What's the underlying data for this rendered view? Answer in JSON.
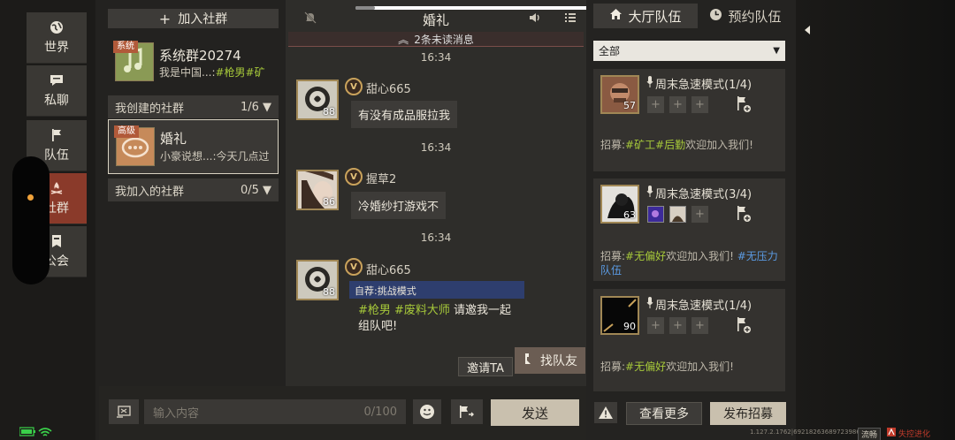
{
  "nav": {
    "items": [
      {
        "label": "世界",
        "icon": "globe-icon"
      },
      {
        "label": "私聊",
        "icon": "chat-bubble-icon"
      },
      {
        "label": "队伍",
        "icon": "flag-icon"
      },
      {
        "label": "社群",
        "icon": "campfire-icon"
      },
      {
        "label": "公会",
        "icon": "guild-banner-icon"
      }
    ],
    "active": "社群"
  },
  "community": {
    "add_label": "加入社群",
    "system_group": {
      "tag": "系统",
      "name": "系统群20274",
      "msg_prefix": "我是中国...:",
      "msg_hashtags": "#枪男#矿"
    },
    "created_section": {
      "label": "我创建的社群",
      "count": "1/6"
    },
    "created_group": {
      "tag": "高级",
      "name": "婚礼",
      "msg": "小豪说想...:今天几点过"
    },
    "joined_section": {
      "label": "我加入的社群",
      "count": "0/5"
    }
  },
  "chat": {
    "title": "婚礼",
    "unread": "2条未读消息",
    "messages": [
      {
        "time": "16:34",
        "sender": "甜心665",
        "level": "88",
        "vip": "V",
        "text": "有没有成品服拉我"
      },
      {
        "time": "16:34",
        "sender": "握草2",
        "level": "86",
        "vip": "V",
        "text": "冷婚纱打游戏不"
      },
      {
        "time": "16:34",
        "sender": "甜心665",
        "level": "88",
        "vip": "V",
        "invite_mode": "自荐:挑战模式",
        "invite_tags": "#枪男 #废料大师",
        "invite_line1_suffix": " 请邀我一起",
        "invite_line2": "组队吧!"
      }
    ],
    "invite_ta": "邀请TA",
    "find_team": "找队友",
    "input_placeholder": "输入内容",
    "input_count": "0/100",
    "send": "发送"
  },
  "teams": {
    "tab_hall": "大厅队伍",
    "tab_reserve": "预约队伍",
    "filter": "全部",
    "cards": [
      {
        "mode": "周末急速模式(1/4)",
        "level": "57",
        "recruit_prefix": "招募:",
        "recruit_tags": "#矿工#后勤",
        "recruit_suffix": "欢迎加入我们!",
        "recruit_extra": ""
      },
      {
        "mode": "周末急速模式(3/4)",
        "level": "63",
        "recruit_prefix": "招募:",
        "recruit_tags": "#无偏好",
        "recruit_suffix": "欢迎加入我们!",
        "recruit_extra": "#无压力队伍"
      },
      {
        "mode": "周末急速模式(1/4)",
        "level": "90",
        "recruit_prefix": "招募:",
        "recruit_tags": "#无偏好",
        "recruit_suffix": "欢迎加入我们!",
        "recruit_extra": ""
      }
    ],
    "more": "查看更多",
    "publish": "发布招募"
  },
  "footer": {
    "version": "1.127.2.1762|69218263689723986",
    "quality": "流畅",
    "logo": "失控进化"
  },
  "colors": {
    "accent_red": "#8a3a2a",
    "hashtag_green": "#a7c93a",
    "hashtag_blue": "#5b9be3",
    "send_button": "#c9c0ae"
  }
}
